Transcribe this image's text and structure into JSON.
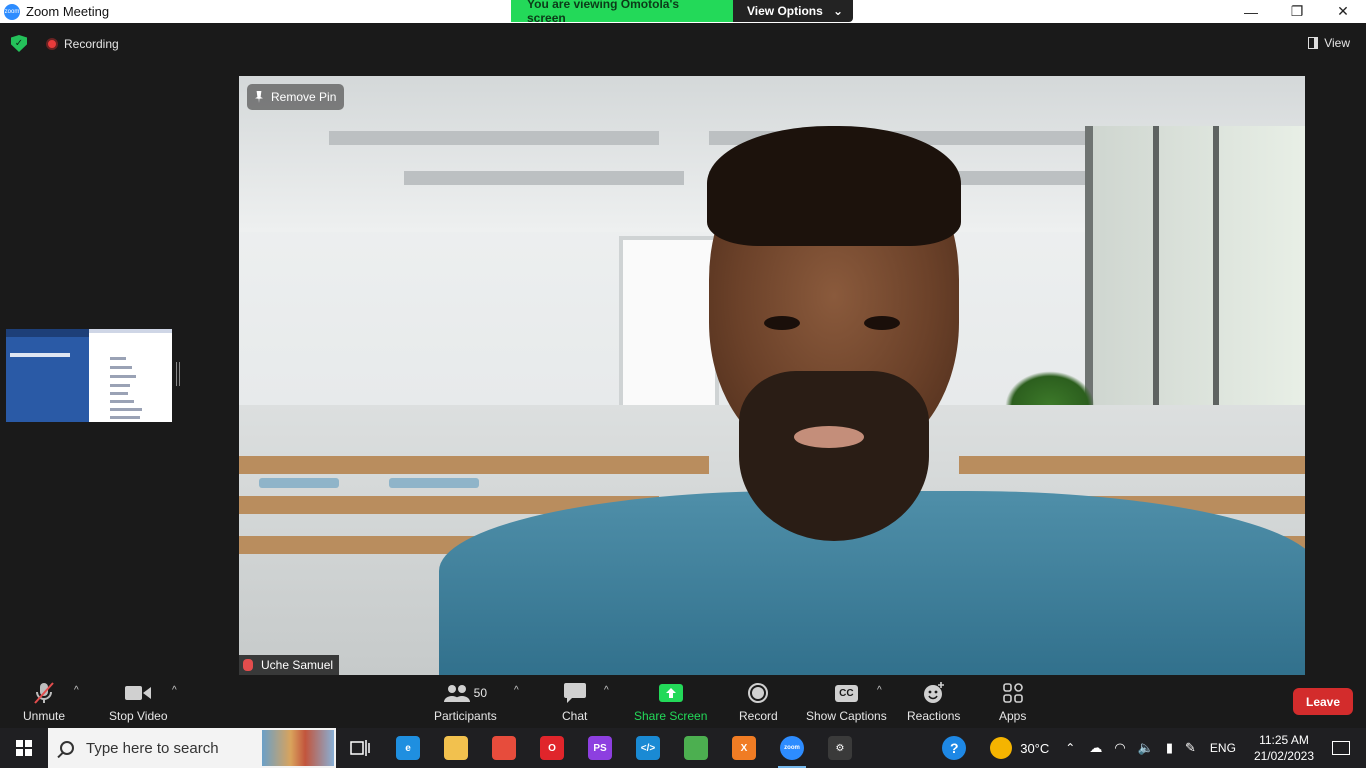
{
  "window": {
    "title": "Zoom Meeting",
    "banner_text": "You are viewing Omotola's screen",
    "view_options_label": "View Options",
    "minimize": "—",
    "restore": "❐",
    "close": "✕"
  },
  "meeting_bar": {
    "recording_label": "Recording",
    "view_label": "View"
  },
  "video": {
    "remove_pin_label": "Remove Pin",
    "participant_name": "Uche Samuel"
  },
  "toolbar": {
    "unmute": "Unmute",
    "stop_video": "Stop Video",
    "participants_count": "50",
    "participants": "Participants",
    "chat": "Chat",
    "share_screen": "Share Screen",
    "record": "Record",
    "show_captions": "Show Captions",
    "captions_icon_text": "CC",
    "reactions": "Reactions",
    "apps": "Apps",
    "leave": "Leave"
  },
  "taskbar": {
    "search_placeholder": "Type here to search",
    "weather": "30°C",
    "language": "ENG",
    "time": "11:25 AM",
    "date": "21/02/2023",
    "apps": [
      {
        "name": "edge-icon",
        "color": "#1f8fe0",
        "text": "e"
      },
      {
        "name": "file-explorer-icon",
        "color": "#f2c14e",
        "text": ""
      },
      {
        "name": "chrome-icon",
        "color": "#e74c3c",
        "text": ""
      },
      {
        "name": "opera-icon",
        "color": "#e0252b",
        "text": "O"
      },
      {
        "name": "phpstorm-icon",
        "color": "#8d3fe0",
        "text": "PS"
      },
      {
        "name": "vscode-icon",
        "color": "#1a8ad4",
        "text": "</>"
      },
      {
        "name": "nodejs-icon",
        "color": "#4caf50",
        "text": ""
      },
      {
        "name": "xampp-icon",
        "color": "#f07c24",
        "text": "X"
      },
      {
        "name": "zoom-icon",
        "color": "#2d8cff",
        "text": "zoom"
      },
      {
        "name": "settings-icon",
        "color": "#3a3a3a",
        "text": "⚙"
      }
    ]
  },
  "colors": {
    "banner_green": "#23d959",
    "leave_red": "#d32c2c",
    "share_green": "#23d959",
    "zoom_blue": "#2d8cff"
  }
}
